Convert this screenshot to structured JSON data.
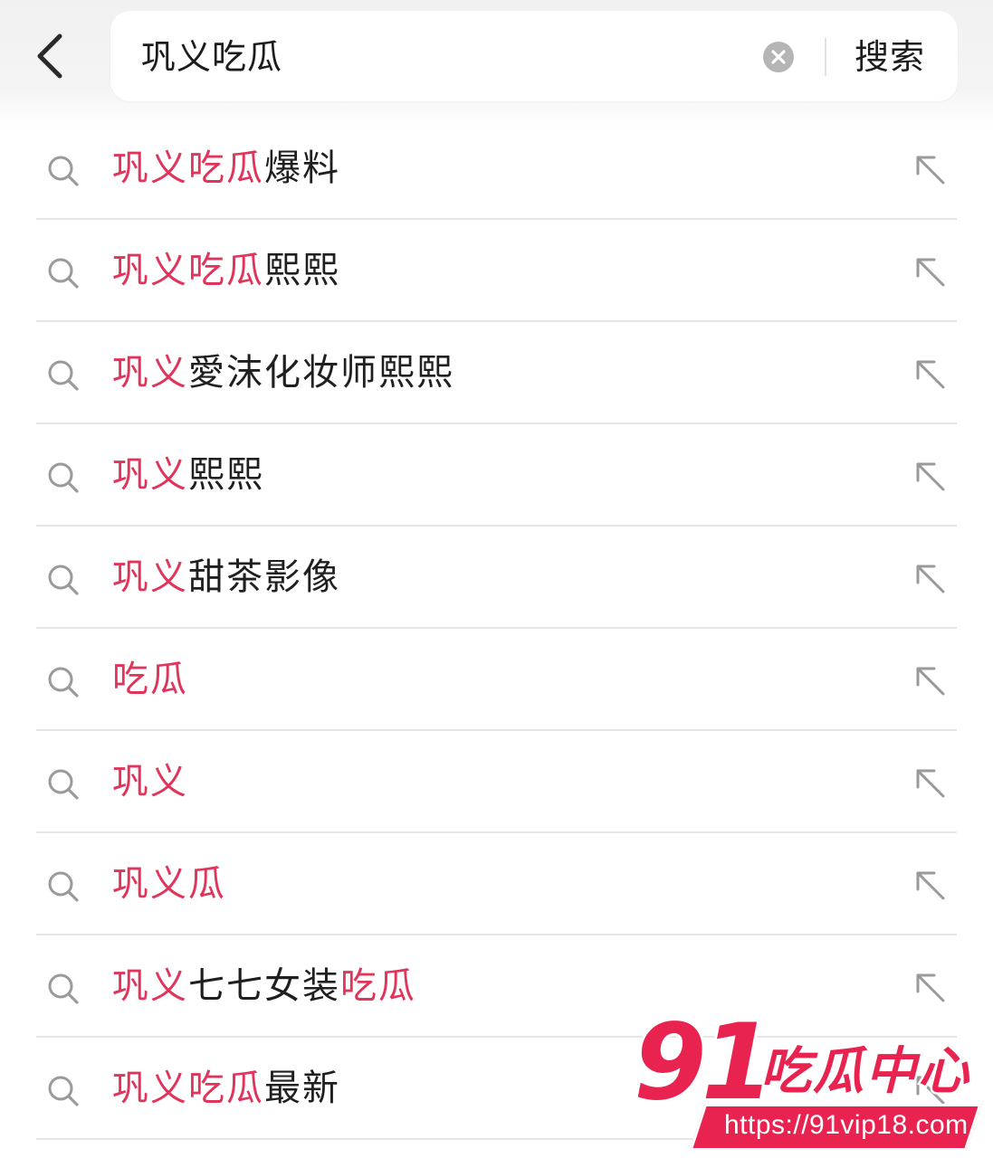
{
  "search": {
    "query": "巩义吃瓜",
    "button_label": "搜索",
    "back_icon": "chevron-left-icon",
    "clear_icon": "clear-circle-icon"
  },
  "colors": {
    "highlight": "#e0345b",
    "text": "#1f1f1f",
    "icon": "#9a9a9a"
  },
  "suggestions": [
    {
      "parts": [
        {
          "t": "巩义吃瓜",
          "hl": true
        },
        {
          "t": "爆料",
          "hl": false
        }
      ]
    },
    {
      "parts": [
        {
          "t": "巩义吃瓜",
          "hl": true
        },
        {
          "t": "熙熙",
          "hl": false
        }
      ]
    },
    {
      "parts": [
        {
          "t": "巩义",
          "hl": true
        },
        {
          "t": "愛沫化妆师熙熙",
          "hl": false
        }
      ]
    },
    {
      "parts": [
        {
          "t": "巩义",
          "hl": true
        },
        {
          "t": "熙熙",
          "hl": false
        }
      ]
    },
    {
      "parts": [
        {
          "t": "巩义",
          "hl": true
        },
        {
          "t": "甜茶影像",
          "hl": false
        }
      ]
    },
    {
      "parts": [
        {
          "t": "吃瓜",
          "hl": true
        }
      ]
    },
    {
      "parts": [
        {
          "t": "巩义",
          "hl": true
        }
      ]
    },
    {
      "parts": [
        {
          "t": "巩义瓜",
          "hl": true
        }
      ]
    },
    {
      "parts": [
        {
          "t": "巩义",
          "hl": true
        },
        {
          "t": "七七女装",
          "hl": false
        },
        {
          "t": "吃瓜",
          "hl": true
        }
      ]
    },
    {
      "parts": [
        {
          "t": "巩义吃瓜",
          "hl": true
        },
        {
          "t": "最新",
          "hl": false
        }
      ]
    }
  ],
  "watermark": {
    "number": "91",
    "name": "吃瓜中心",
    "url": "https://91vip18.com"
  }
}
